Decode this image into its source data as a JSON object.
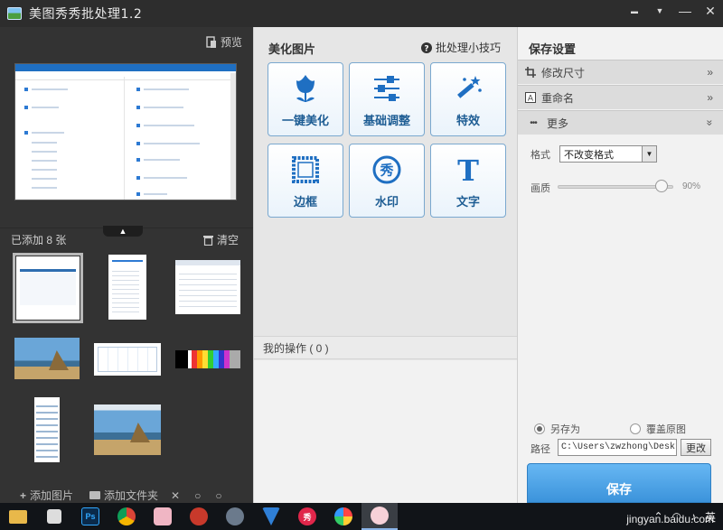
{
  "window": {
    "title": "美图秀秀批处理1.2",
    "minimize": "▬",
    "menu": "▼",
    "min_glyph": "—",
    "close_glyph": "✕"
  },
  "left": {
    "preview_label": "预览",
    "added_count": "已添加 8 张",
    "clear_label": "清空",
    "collapse_glyph": "▲",
    "add_image": "添加图片",
    "add_folder": "添加文件夹"
  },
  "middle": {
    "title": "美化图片",
    "tips": "批处理小技巧",
    "tools": [
      {
        "label": "一键美化",
        "icon": "tulip-icon"
      },
      {
        "label": "基础调整",
        "icon": "sliders-icon"
      },
      {
        "label": "特效",
        "icon": "magic-wand-icon"
      },
      {
        "label": "边框",
        "icon": "frame-icon"
      },
      {
        "label": "水印",
        "icon": "watermark-seal-icon"
      },
      {
        "label": "文字",
        "icon": "text-t-icon"
      }
    ],
    "watermark_char": "秀",
    "text_char": "T",
    "my_operations": "我的操作 ( 0 )"
  },
  "right": {
    "title": "保存设置",
    "resize": "修改尺寸",
    "rename": "重命名",
    "more": "更多",
    "format_label": "格式",
    "format_value": "不改变格式",
    "quality_label": "画质",
    "quality_percent": "90%",
    "quality": 0.9,
    "save_as": "另存为",
    "overwrite": "覆盖原图",
    "path_label": "路径",
    "path_value": "C:\\Users\\zwzhong\\Desktop\\",
    "change_btn": "更改",
    "save_btn": "保存"
  },
  "taskbar": {
    "ime": "英",
    "watermark": "jingyan.baidu.com"
  },
  "colors": {
    "accent": "#3b93db",
    "tool_border": "#7aa8cf",
    "tool_text": "#1e5d94"
  }
}
